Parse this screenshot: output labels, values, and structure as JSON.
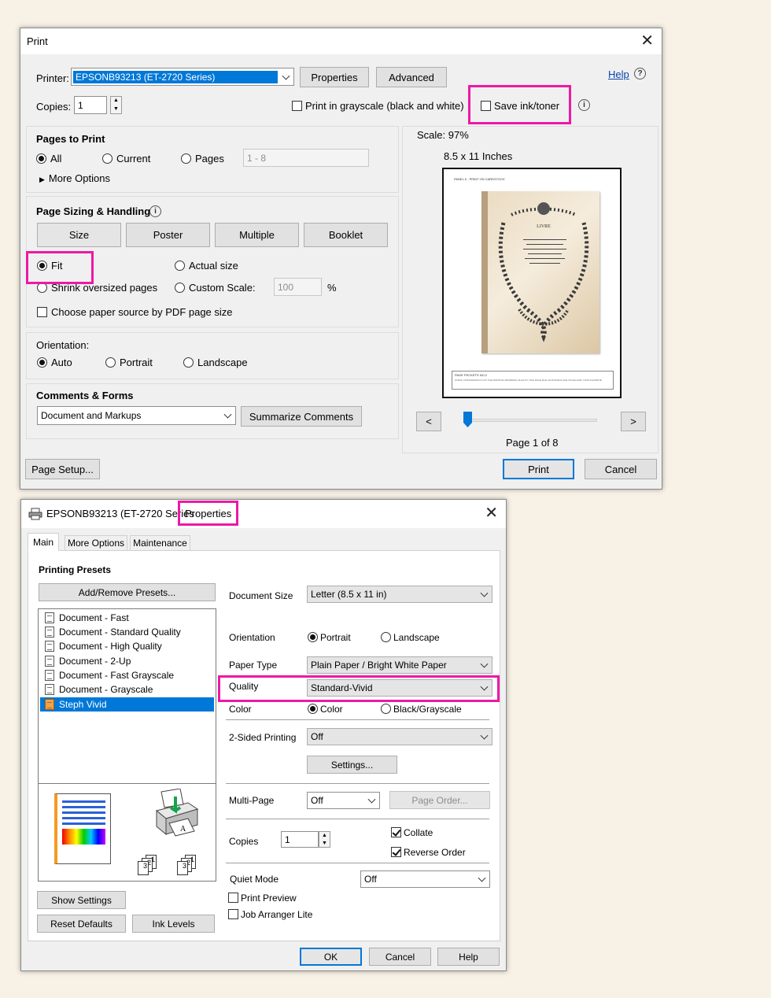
{
  "print_dialog": {
    "title": "Print",
    "printer_label": "Printer:",
    "printer_value": "EPSONB93213 (ET-2720 Series)",
    "properties_button": "Properties",
    "advanced_button": "Advanced",
    "help_link": "Help",
    "copies_label": "Copies:",
    "copies_value": "1",
    "grayscale_label": "Print in grayscale (black and white)",
    "save_ink_label": "Save ink/toner",
    "pages_to_print": {
      "heading": "Pages to Print",
      "all": "All",
      "current": "Current",
      "pages": "Pages",
      "pages_range": "1 - 8",
      "more_options": "More Options"
    },
    "sizing": {
      "heading": "Page Sizing & Handling",
      "size_button": "Size",
      "poster_button": "Poster",
      "multiple_button": "Multiple",
      "booklet_button": "Booklet",
      "fit": "Fit",
      "actual_size": "Actual size",
      "shrink": "Shrink oversized pages",
      "custom_scale": "Custom Scale:",
      "custom_scale_value": "100",
      "percent": "%",
      "paper_source": "Choose paper source by PDF page size"
    },
    "orientation": {
      "heading": "Orientation:",
      "auto": "Auto",
      "portrait": "Portrait",
      "landscape": "Landscape"
    },
    "comments": {
      "heading": "Comments & Forms",
      "value": "Document and Markups",
      "summarize_button": "Summarize Comments"
    },
    "preview": {
      "scale": "Scale:  97%",
      "paper": "8.5 x 11 Inches",
      "prev": "<",
      "next": ">",
      "page_indicator": "Page 1 of 8",
      "panel_header": "PANEL 6 - PRINT ON CARDSTOCK",
      "card_title": "LIVRE",
      "footer_title": "PAGE PECKETS NO.2",
      "footer_text": "STEPH VIVIDGRAPHICS CAT THE PRINTING PEORNING SLIGHTY THIS PAGE FILE COUNTRE PLACE ON EACHOF YOUR FAVORITE"
    },
    "page_setup_button": "Page Setup...",
    "print_button": "Print",
    "cancel_button": "Cancel"
  },
  "properties_dialog": {
    "title_prefix": "EPSONB93213 (ET-2720 Series",
    "title_highlight": "Properties",
    "tabs": [
      "Main",
      "More Options",
      "Maintenance"
    ],
    "printing_presets_heading": "Printing Presets",
    "add_remove_button": "Add/Remove Presets...",
    "presets": [
      "Document - Fast",
      "Document - Standard Quality",
      "Document - High Quality",
      "Document - 2-Up",
      "Document - Fast Grayscale",
      "Document - Grayscale",
      "Steph Vivid"
    ],
    "show_settings_button": "Show Settings",
    "reset_defaults_button": "Reset Defaults",
    "ink_levels_button": "Ink Levels",
    "document_size_label": "Document Size",
    "document_size_value": "Letter (8.5 x 11 in)",
    "orientation_label": "Orientation",
    "portrait": "Portrait",
    "landscape": "Landscape",
    "paper_type_label": "Paper Type",
    "paper_type_value": "Plain Paper / Bright White Paper",
    "quality_label": "Quality",
    "quality_value": "Standard-Vivid",
    "color_label": "Color",
    "color_option": "Color",
    "bw_option": "Black/Grayscale",
    "two_sided_label": "2-Sided Printing",
    "two_sided_value": "Off",
    "settings_button": "Settings...",
    "multipage_label": "Multi-Page",
    "multipage_value": "Off",
    "page_order_button": "Page Order...",
    "copies_label": "Copies",
    "copies_value": "1",
    "collate": "Collate",
    "reverse_order": "Reverse Order",
    "quiet_mode_label": "Quiet Mode",
    "quiet_mode_value": "Off",
    "print_preview": "Print Preview",
    "job_arranger": "Job Arranger Lite",
    "ok_button": "OK",
    "cancel_button": "Cancel",
    "help_button": "Help",
    "copy_stack_labels": [
      "3",
      "2",
      "1"
    ]
  },
  "colors": {
    "highlight": "#ec1aa5",
    "selection": "#0078d7",
    "background": "#f7f1e6"
  }
}
